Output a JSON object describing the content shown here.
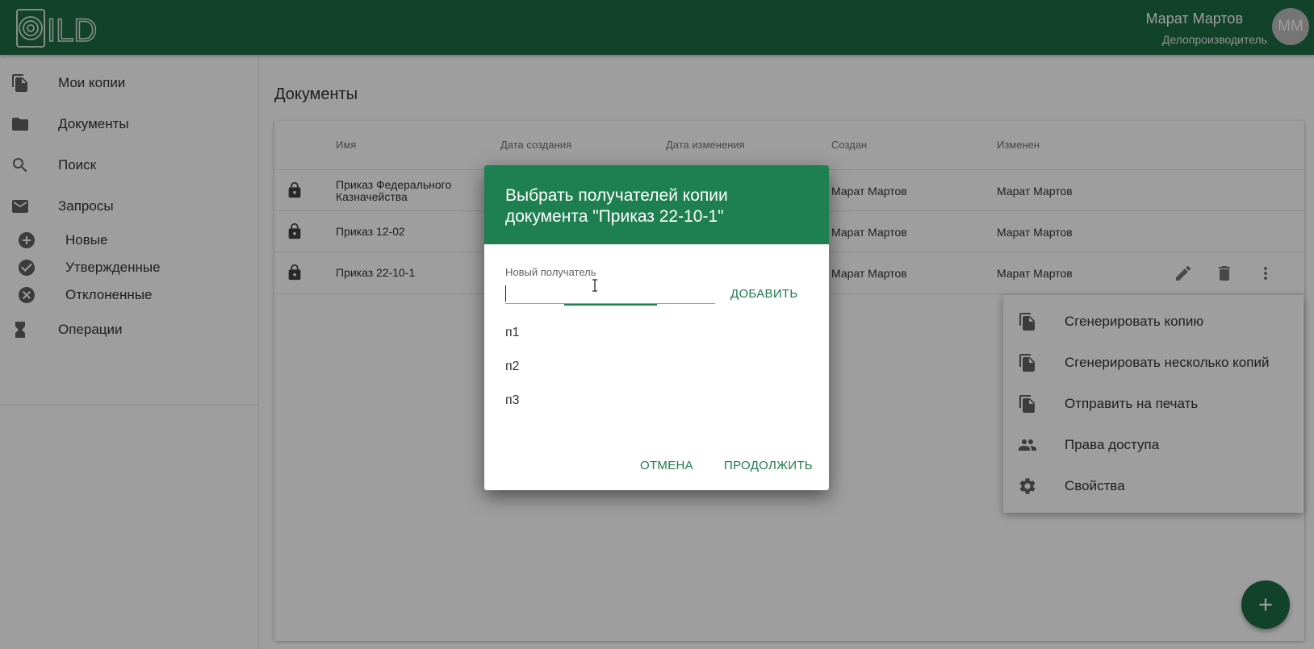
{
  "app": {
    "logo_text": "ILD",
    "user_name": "Марат Мартов",
    "user_role": "Делопроизводитель",
    "avatar_initials": "ММ",
    "brand_color": "#1e6b45"
  },
  "sidebar": {
    "items": [
      {
        "label": "Мои копии",
        "icon": "file-copy-icon"
      },
      {
        "label": "Документы",
        "icon": "folder-icon"
      },
      {
        "label": "Поиск",
        "icon": "search-icon"
      },
      {
        "label": "Запросы",
        "icon": "mail-icon"
      },
      {
        "label": "Операции",
        "icon": "hourglass-icon"
      }
    ],
    "request_subitems": [
      {
        "label": "Новые",
        "icon": "add-circle-icon"
      },
      {
        "label": "Утвержденные",
        "icon": "check-circle-icon"
      },
      {
        "label": "Отклоненные",
        "icon": "cancel-circle-icon"
      }
    ]
  },
  "main": {
    "title": "Документы",
    "columns": [
      "Имя",
      "Дата создания",
      "Дата изменения",
      "Создан",
      "Изменен"
    ],
    "rows": [
      {
        "name": "Приказ Федерального Казначейства",
        "created_by": "Марат Мартов",
        "modified_by": "Марат Мартов"
      },
      {
        "name": "Приказ 12-02",
        "created_by": "Марат Мартов",
        "modified_by": "Марат Мартов"
      },
      {
        "name": "Приказ 22-10-1",
        "created_by": "Марат Мартов",
        "modified_by": "Марат Мартов"
      }
    ]
  },
  "context_menu": {
    "items": [
      {
        "label": "Сгенерировать копию",
        "icon": "file-copy-icon"
      },
      {
        "label": "Сгенерировать несколько копий",
        "icon": "file-copy-icon"
      },
      {
        "label": "Отправить на печать",
        "icon": "file-copy-icon"
      },
      {
        "label": "Права доступа",
        "icon": "people-icon"
      },
      {
        "label": "Свойства",
        "icon": "gear-icon"
      }
    ]
  },
  "dialog": {
    "title": "Выбрать получателей копии документа \"Приказ 22-10-1\"",
    "field_label": "Новый получатель",
    "field_value": "",
    "add_label": "ДОБАВИТЬ",
    "recipients": [
      "п1",
      "п2",
      "п3"
    ],
    "cancel_label": "ОТМЕНА",
    "continue_label": "ПРОДОЛЖИТЬ"
  }
}
